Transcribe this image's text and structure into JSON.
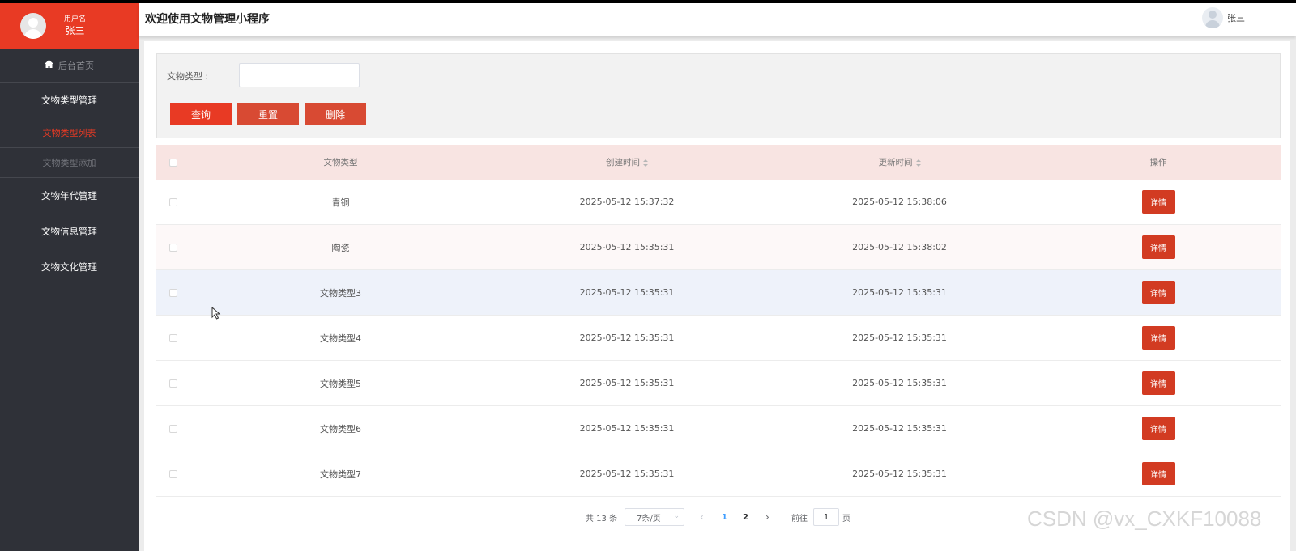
{
  "sidebar": {
    "user_label": "用户名",
    "user_name": "张三",
    "home": "后台首页",
    "groups": [
      {
        "label": "文物类型管理"
      },
      {
        "label": "文物年代管理"
      },
      {
        "label": "文物信息管理"
      },
      {
        "label": "文物文化管理"
      }
    ],
    "subitems": [
      {
        "label": "文物类型列表"
      },
      {
        "label": "文物类型添加"
      }
    ]
  },
  "header": {
    "title": "欢迎使用文物管理小程序",
    "user_name": "张三"
  },
  "search": {
    "label": "文物类型 :",
    "value": "",
    "buttons": {
      "query": "查询",
      "reset": "重置",
      "delete": "删除"
    }
  },
  "table": {
    "columns": {
      "type": "文物类型",
      "created": "创建时间",
      "updated": "更新时间",
      "ops": "操作"
    },
    "rows": [
      {
        "type": "青铜",
        "created": "2025-05-12 15:37:32",
        "updated": "2025-05-12 15:38:06",
        "action": "详情"
      },
      {
        "type": "陶瓷",
        "created": "2025-05-12 15:35:31",
        "updated": "2025-05-12 15:38:02",
        "action": "详情"
      },
      {
        "type": "文物类型3",
        "created": "2025-05-12 15:35:31",
        "updated": "2025-05-12 15:35:31",
        "action": "详情"
      },
      {
        "type": "文物类型4",
        "created": "2025-05-12 15:35:31",
        "updated": "2025-05-12 15:35:31",
        "action": "详情"
      },
      {
        "type": "文物类型5",
        "created": "2025-05-12 15:35:31",
        "updated": "2025-05-12 15:35:31",
        "action": "详情"
      },
      {
        "type": "文物类型6",
        "created": "2025-05-12 15:35:31",
        "updated": "2025-05-12 15:35:31",
        "action": "详情"
      },
      {
        "type": "文物类型7",
        "created": "2025-05-12 15:35:31",
        "updated": "2025-05-12 15:35:31",
        "action": "详情"
      }
    ]
  },
  "pagination": {
    "total": "共 13 条",
    "page_size": "7条/页",
    "pages": [
      "1",
      "2"
    ],
    "current_page": "1",
    "goto_prefix": "前往",
    "goto_value": "1",
    "goto_suffix": "页"
  },
  "watermark": "CSDN @vx_CXKF10088",
  "colors": {
    "brand": "#e83a24",
    "sidebar": "#2f3138",
    "table_header": "#f8e4e2",
    "active_page": "#409eff"
  }
}
